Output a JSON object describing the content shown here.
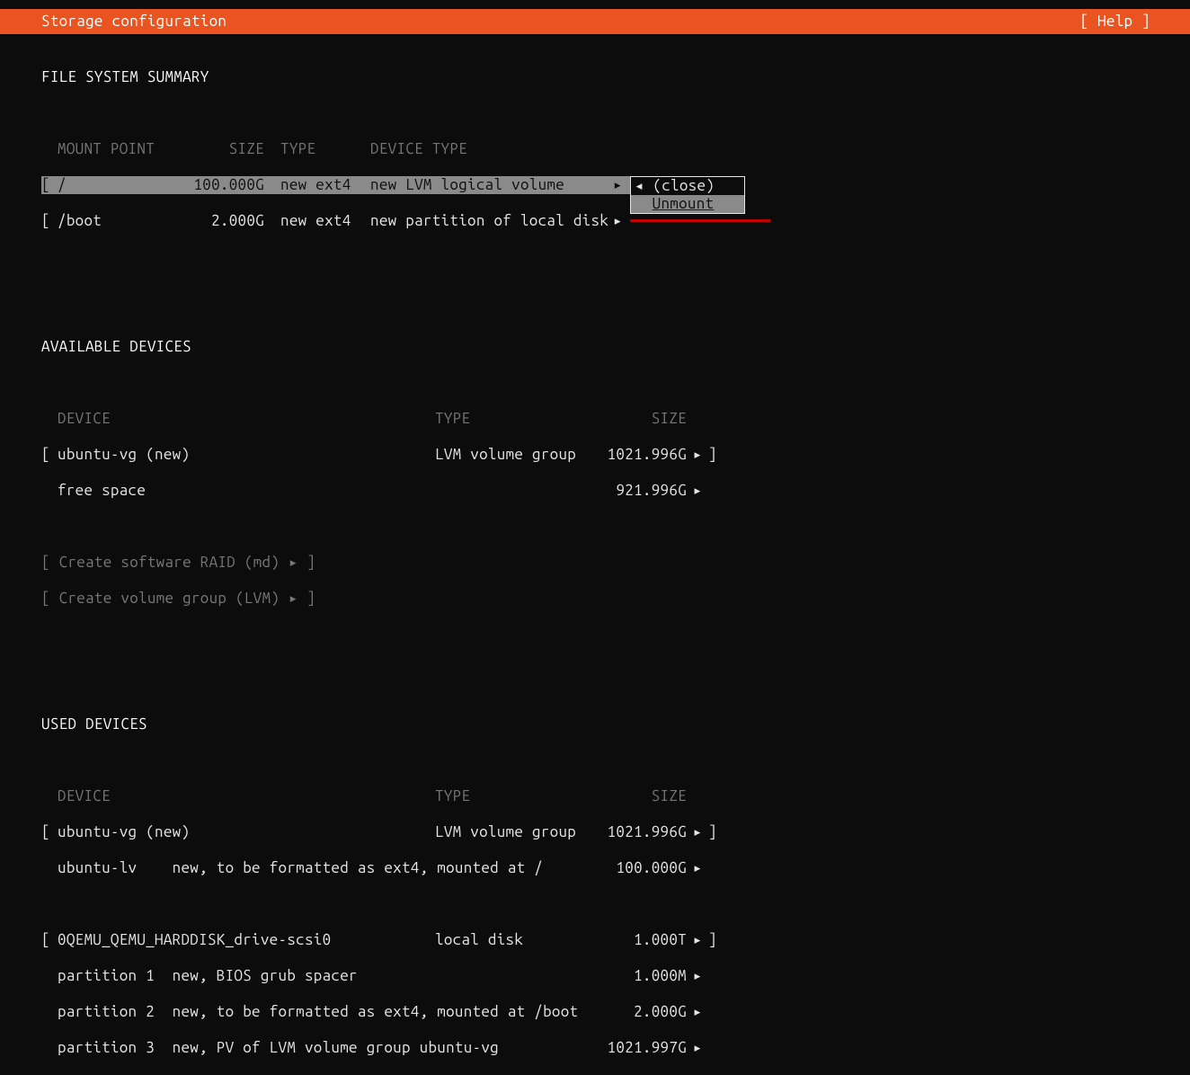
{
  "header": {
    "title": "Storage configuration",
    "help": "[ Help ]"
  },
  "fs_summary": {
    "heading": "FILE SYSTEM SUMMARY",
    "cols": {
      "mount": "MOUNT POINT",
      "size": "SIZE",
      "type": "TYPE",
      "devtype": "DEVICE TYPE"
    },
    "rows": [
      {
        "lb": "[",
        "mount": "/",
        "size": "100.000G",
        "type": "new ext4",
        "devtype": "new LVM logical volume",
        "arrow": "▸",
        "rb": ""
      },
      {
        "lb": "[",
        "mount": "/boot",
        "size": "2.000G",
        "type": "new ext4",
        "devtype": "new partition of local disk",
        "arrow": "▸",
        "rb": ""
      }
    ]
  },
  "popup": {
    "close_arrow": "◂",
    "close_label": "(close)",
    "unmount": "Unmount"
  },
  "available": {
    "heading": "AVAILABLE DEVICES",
    "cols": {
      "device": "DEVICE",
      "type": "TYPE",
      "size": "SIZE"
    },
    "rows": [
      {
        "lb": "[",
        "device": "ubuntu-vg (new)",
        "type": "LVM volume group",
        "size": "1021.996G",
        "arrow": "▸",
        "rb": "]"
      },
      {
        "lb": " ",
        "device": "free space",
        "type": "",
        "size": "921.996G",
        "arrow": "▸",
        "rb": ""
      }
    ],
    "raid": "[ Create software RAID (md) ▸ ]",
    "lvm": "[ Create volume group (LVM) ▸ ]"
  },
  "used": {
    "heading": "USED DEVICES",
    "cols": {
      "device": "DEVICE",
      "type": "TYPE",
      "size": "SIZE"
    },
    "rows": [
      {
        "lb": "[",
        "device": "ubuntu-vg (new)",
        "type": "LVM volume group",
        "size": "1021.996G",
        "arrow": "▸",
        "rb": "]"
      },
      {
        "lb": " ",
        "device": "ubuntu-lv    new, to be formatted as ext4, mounted at /",
        "type": "",
        "size": "100.000G",
        "arrow": "▸",
        "rb": ""
      }
    ],
    "rows2": [
      {
        "lb": "[",
        "device": "0QEMU_QEMU_HARDDISK_drive-scsi0",
        "type": "local disk",
        "size": "1.000T",
        "arrow": "▸",
        "rb": "]"
      },
      {
        "lb": " ",
        "device": "partition 1  new, BIOS grub spacer",
        "type": "",
        "size": "1.000M",
        "arrow": "▸",
        "rb": ""
      },
      {
        "lb": " ",
        "device": "partition 2  new, to be formatted as ext4, mounted at /boot",
        "type": "",
        "size": "2.000G",
        "arrow": "▸",
        "rb": ""
      },
      {
        "lb": " ",
        "device": "partition 3  new, PV of LVM volume group ubuntu-vg",
        "type": "",
        "size": "1021.997G",
        "arrow": "▸",
        "rb": ""
      }
    ]
  }
}
